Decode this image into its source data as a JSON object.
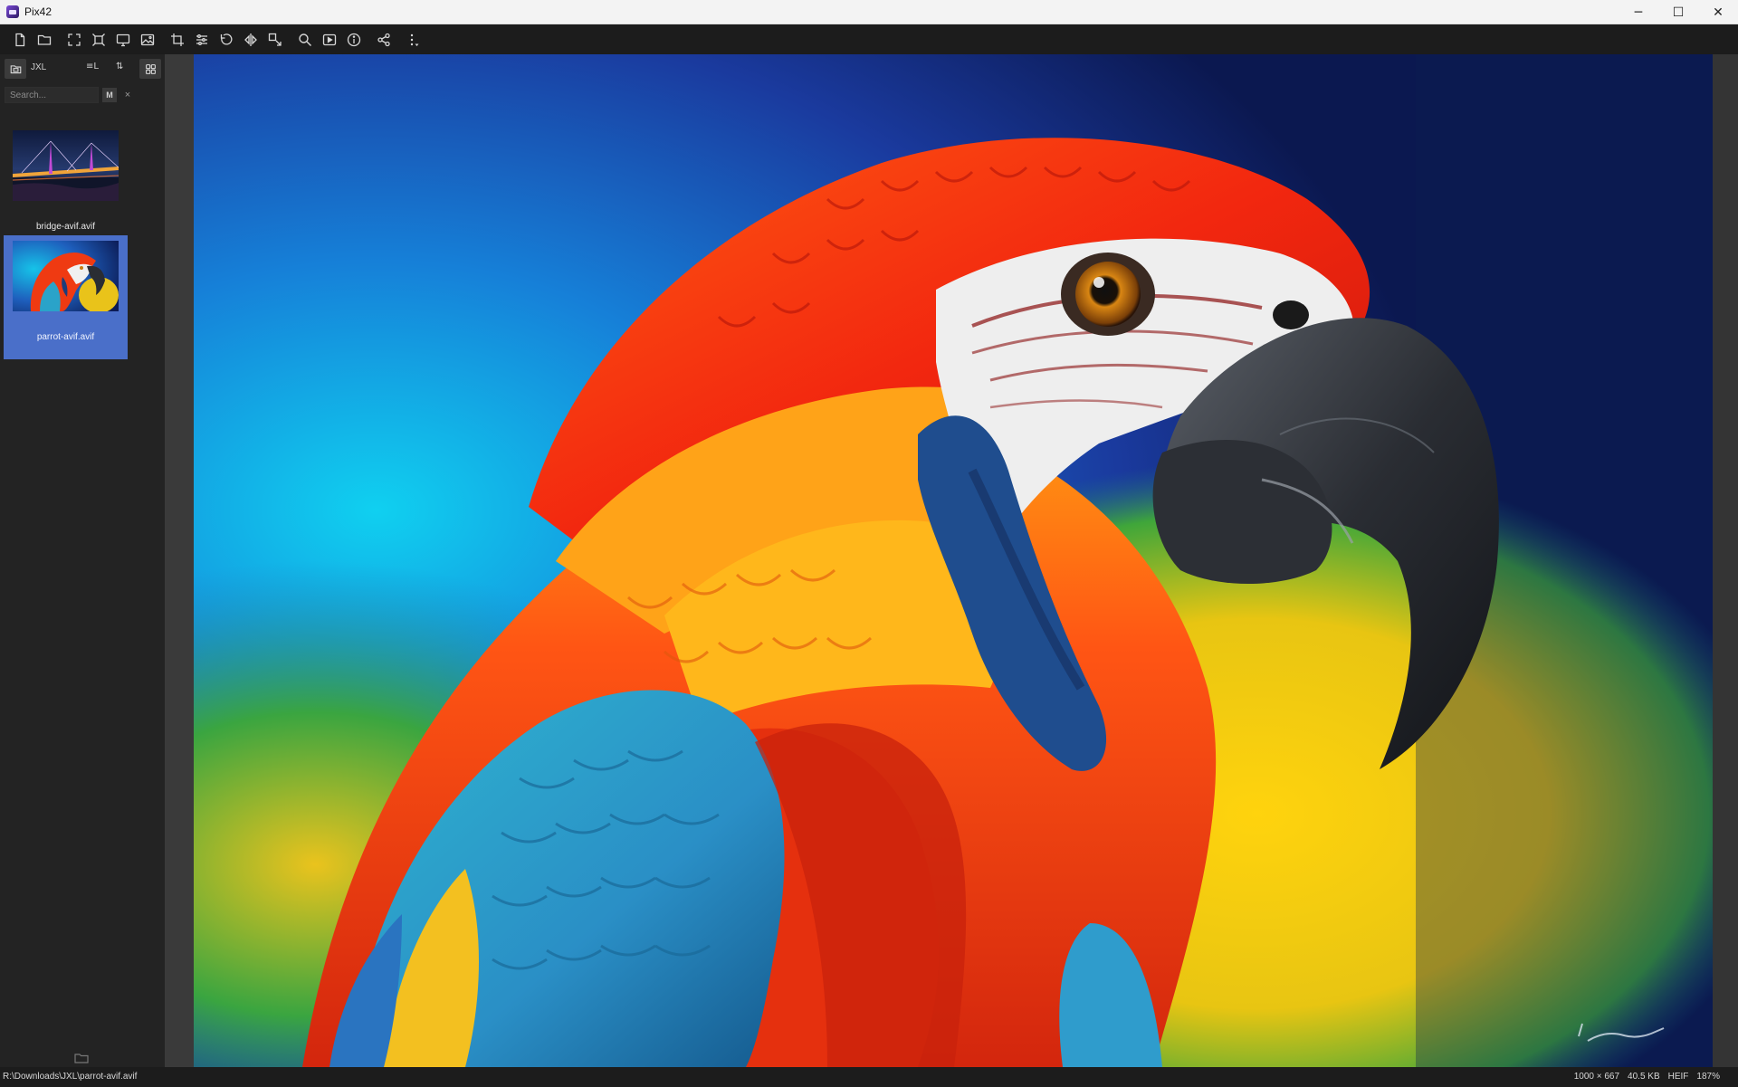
{
  "window": {
    "title": "Pix42",
    "minimize_glyph": "─",
    "maximize_glyph": "☐",
    "close_glyph": "✕"
  },
  "toolbar": {
    "buttons": [
      "new-file-icon",
      "open-folder-icon",
      "fullscreen-icon",
      "fit-window-icon",
      "slideshow-monitor-icon",
      "wallpaper-icon",
      "crop-icon",
      "adjust-icon",
      "rotate-icon",
      "flip-icon",
      "resize-icon",
      "zoom-icon",
      "play-icon",
      "info-icon",
      "share-icon",
      "more-icon"
    ]
  },
  "sidebar": {
    "folder_label": "JXL",
    "sort_label": "≡L",
    "order_label": "⇅",
    "search": {
      "placeholder": "Search...",
      "value": ""
    },
    "match_label": "M",
    "clear_label": "×",
    "items": [
      {
        "label": "bridge-avif.avif",
        "selected": false
      },
      {
        "label": "parrot-avif.avif",
        "selected": true
      }
    ]
  },
  "status": {
    "path": "R:\\Downloads\\JXL\\parrot-avif.avif",
    "dimensions": "1000 × 667",
    "size": "40.5 KB",
    "format": "HEIF",
    "zoom": "187%"
  },
  "colors": {
    "accent_selection": "#4a6fc9",
    "toolbar_bg": "#1c1c1c",
    "sidebar_bg": "#232323",
    "titlebar_bg": "#f3f3f3"
  }
}
